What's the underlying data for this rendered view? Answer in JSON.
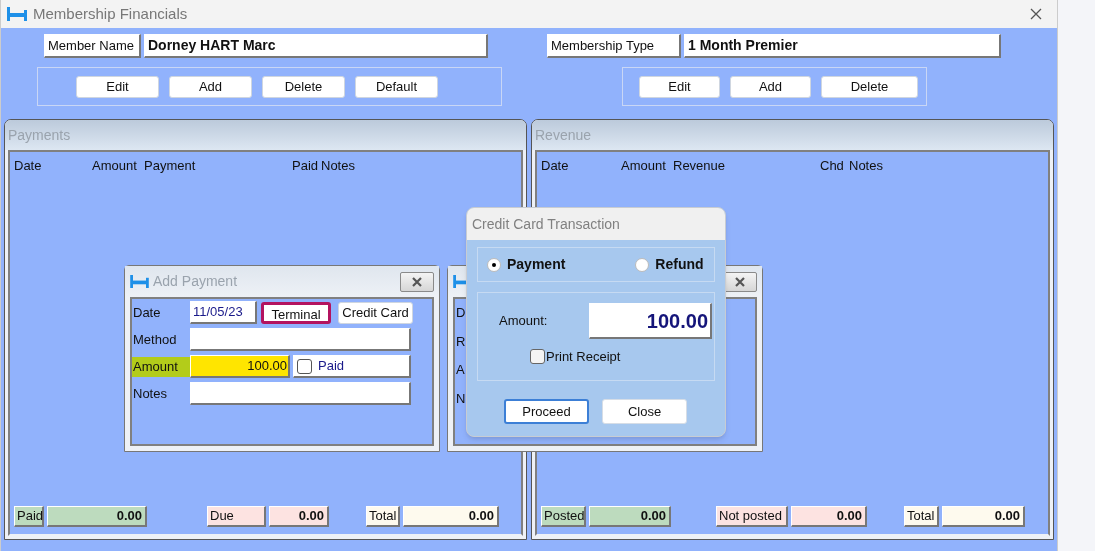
{
  "window": {
    "title": "Membership Financials"
  },
  "header": [
    {
      "label": "Member Name",
      "value": "Dorney HART Marc",
      "buttons": [
        "Edit",
        "Add",
        "Delete",
        "Default"
      ]
    },
    {
      "label": "Membership Type",
      "value": "1 Month Premier",
      "buttons": [
        "Edit",
        "Add",
        "Delete"
      ]
    }
  ],
  "panels": [
    {
      "title": "Payments",
      "columns": [
        "Date",
        "Amount",
        "Payment",
        "Paid",
        "Notes"
      ],
      "totals": [
        {
          "label": "Paid",
          "value": "0.00",
          "color": "#bddbbe"
        },
        {
          "label": "Due",
          "value": "0.00",
          "color": "#fde3e1"
        },
        {
          "label": "Total",
          "value": "0.00",
          "color": "#fefaee"
        }
      ]
    },
    {
      "title": "Revenue",
      "columns": [
        "Date",
        "Amount",
        "Revenue",
        "Chd",
        "Notes"
      ],
      "totals": [
        {
          "label": "Posted",
          "value": "0.00",
          "color": "#bddbbe"
        },
        {
          "label": "Not posted",
          "value": "0.00",
          "color": "#fde3e1"
        },
        {
          "label": "Total",
          "value": "0.00",
          "color": "#fefaee"
        }
      ]
    }
  ],
  "add_payment": {
    "title": "Add Payment",
    "date_label": "Date",
    "date": "11/05/23",
    "date_buttons": [
      {
        "label": "Terminal",
        "outlined": true
      },
      {
        "label": "Credit Card",
        "outlined": false
      }
    ],
    "method_label": "Method",
    "amount_label": "Amount",
    "amount": "100.00",
    "amount_highlighted": true,
    "paid": {
      "label": "Paid",
      "checked": false
    },
    "notes_label": "Notes"
  },
  "hidden_dialog": {
    "labels": [
      "D",
      "R",
      "A",
      "N"
    ]
  },
  "credit_card": {
    "title": "Credit Card Transaction",
    "options": [
      {
        "label": "Payment",
        "selected": true
      },
      {
        "label": "Refund",
        "selected": false
      }
    ],
    "amount_label": "Amount:",
    "amount": "100.00",
    "print_receipt": {
      "label": "Print Receipt",
      "checked": false
    },
    "buttons": [
      {
        "label": "Proceed",
        "default": true
      },
      {
        "label": "Close",
        "default": false
      }
    ]
  }
}
